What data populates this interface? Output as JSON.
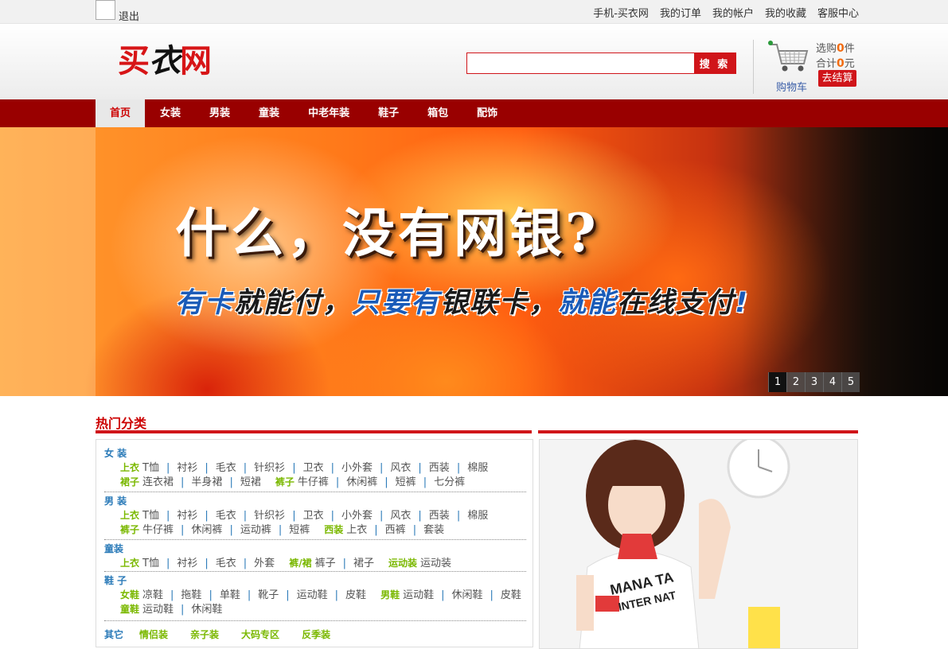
{
  "topbar": {
    "logout_label": "退出",
    "links": [
      "手机-买衣网",
      "我的订单",
      "我的帐户",
      "我的收藏",
      "客服中心"
    ]
  },
  "header": {
    "logo": "买衣网",
    "search": {
      "value": "",
      "placeholder": "",
      "button_label": "搜 索"
    },
    "cart": {
      "label": "购物车",
      "selected_prefix": "选购",
      "selected_count": "0",
      "selected_unit": "件",
      "total_prefix": "合计",
      "total_amount": "0",
      "total_unit": "元",
      "checkout_label": "去结算"
    }
  },
  "nav": {
    "items": [
      "首页",
      "女装",
      "男装",
      "童装",
      "中老年装",
      "鞋子",
      "箱包",
      "配饰"
    ],
    "active_index": 0
  },
  "banner": {
    "headline": "什么，没有网银?",
    "subline_parts": [
      {
        "text": "有卡",
        "tone": "blue"
      },
      {
        "text": "就能付，",
        "tone": "dark"
      },
      {
        "text": "只要有",
        "tone": "blue"
      },
      {
        "text": "银联卡，",
        "tone": "dark"
      },
      {
        "text": "就能",
        "tone": "blue"
      },
      {
        "text": "在线支付",
        "tone": "dark"
      },
      {
        "text": "!",
        "tone": "blue"
      }
    ],
    "pages": [
      "1",
      "2",
      "3",
      "4",
      "5"
    ],
    "active_page": 0
  },
  "hot_category": {
    "title": "热门分类",
    "groups": [
      {
        "title": "女 装",
        "rows": [
          {
            "segments": [
              {
                "sub": "上衣",
                "items": [
                  "T恤",
                  "衬衫",
                  "毛衣",
                  "针织衫",
                  "卫衣",
                  "小外套",
                  "风衣",
                  "西装",
                  "棉服"
                ]
              }
            ]
          },
          {
            "segments": [
              {
                "sub": "裙子",
                "items": [
                  "连衣裙",
                  "半身裙",
                  "短裙"
                ]
              },
              {
                "sub": "裤子",
                "items": [
                  "牛仔裤",
                  "休闲裤",
                  "短裤",
                  "七分裤"
                ]
              }
            ]
          }
        ]
      },
      {
        "title": "男 装",
        "rows": [
          {
            "segments": [
              {
                "sub": "上衣",
                "items": [
                  "T恤",
                  "衬衫",
                  "毛衣",
                  "针织衫",
                  "卫衣",
                  "小外套",
                  "风衣",
                  "西装",
                  "棉服"
                ]
              }
            ]
          },
          {
            "segments": [
              {
                "sub": "裤子",
                "items": [
                  "牛仔裤",
                  "休闲裤",
                  "运动裤",
                  "短裤"
                ]
              },
              {
                "sub": "西装",
                "items": [
                  "上衣",
                  "西裤",
                  "套装"
                ]
              }
            ]
          }
        ]
      },
      {
        "title": "童装",
        "rows": [
          {
            "segments": [
              {
                "sub": "上衣",
                "items": [
                  "T恤",
                  "衬衫",
                  "毛衣",
                  "外套"
                ]
              },
              {
                "sub": "裤/裙",
                "items": [
                  "裤子",
                  "裙子"
                ]
              },
              {
                "sub": "运动装",
                "items": [
                  "运动装"
                ]
              }
            ]
          }
        ]
      },
      {
        "title": "鞋 子",
        "rows": [
          {
            "segments": [
              {
                "sub": "女鞋",
                "items": [
                  "凉鞋",
                  "拖鞋",
                  "单鞋",
                  "靴子",
                  "运动鞋",
                  "皮鞋"
                ]
              },
              {
                "sub": "男鞋",
                "items": [
                  "运动鞋",
                  "休闲鞋",
                  "皮鞋"
                ]
              }
            ]
          },
          {
            "segments": [
              {
                "sub": "童鞋",
                "items": [
                  "运动鞋",
                  "休闲鞋"
                ]
              }
            ]
          }
        ]
      }
    ],
    "other": {
      "title": "其它",
      "items": [
        "情侣装",
        "亲子装",
        "大码专区",
        "反季装"
      ]
    }
  },
  "colors": {
    "brand_red": "#d0151a",
    "nav_bg": "#990000",
    "category_blue": "#2a7ab8",
    "category_green": "#7ab800",
    "count_orange": "#f26b10"
  }
}
